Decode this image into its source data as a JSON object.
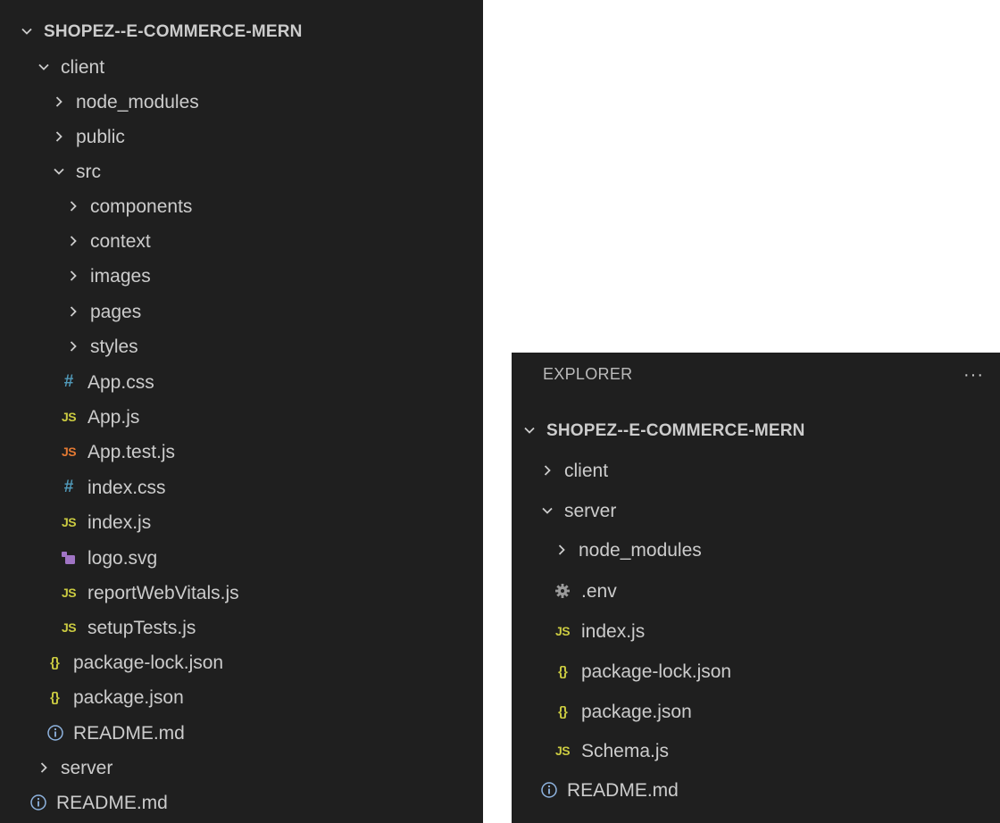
{
  "left_panel": {
    "root": "SHOPEZ--E-COMMERCE-MERN",
    "items": [
      {
        "label": "client",
        "kind": "folder-open"
      },
      {
        "label": "node_modules",
        "kind": "folder-closed"
      },
      {
        "label": "public",
        "kind": "folder-closed"
      },
      {
        "label": "src",
        "kind": "folder-open"
      },
      {
        "label": "components",
        "kind": "folder-closed"
      },
      {
        "label": "context",
        "kind": "folder-closed"
      },
      {
        "label": "images",
        "kind": "folder-closed"
      },
      {
        "label": "pages",
        "kind": "folder-closed"
      },
      {
        "label": "styles",
        "kind": "folder-closed"
      },
      {
        "label": "App.css",
        "kind": "css"
      },
      {
        "label": "App.js",
        "kind": "js"
      },
      {
        "label": "App.test.js",
        "kind": "js-test"
      },
      {
        "label": "index.css",
        "kind": "css"
      },
      {
        "label": "index.js",
        "kind": "js"
      },
      {
        "label": "logo.svg",
        "kind": "svg"
      },
      {
        "label": "reportWebVitals.js",
        "kind": "js"
      },
      {
        "label": "setupTests.js",
        "kind": "js"
      },
      {
        "label": "package-lock.json",
        "kind": "json"
      },
      {
        "label": "package.json",
        "kind": "json"
      },
      {
        "label": "README.md",
        "kind": "info"
      },
      {
        "label": "server",
        "kind": "folder-closed"
      },
      {
        "label": "README.md",
        "kind": "info"
      }
    ]
  },
  "right_panel": {
    "title": "EXPLORER",
    "more": "···",
    "root": "SHOPEZ--E-COMMERCE-MERN",
    "items": [
      {
        "label": "client",
        "kind": "folder-closed"
      },
      {
        "label": "server",
        "kind": "folder-open"
      },
      {
        "label": "node_modules",
        "kind": "folder-closed"
      },
      {
        "label": ".env",
        "kind": "gear"
      },
      {
        "label": "index.js",
        "kind": "js"
      },
      {
        "label": "package-lock.json",
        "kind": "json"
      },
      {
        "label": "package.json",
        "kind": "json"
      },
      {
        "label": "Schema.js",
        "kind": "js"
      },
      {
        "label": "README.md",
        "kind": "info"
      }
    ]
  },
  "icon_glyphs": {
    "js": "JS",
    "css": "#",
    "json": "{}"
  },
  "colors": {
    "background": "#1f1f1f",
    "text": "#cccccc",
    "js": "#cbcb41",
    "js_test": "#e37933",
    "css": "#519aba",
    "json": "#cbcb41",
    "svg": "#a074c4",
    "info": "#8fb4e0"
  }
}
